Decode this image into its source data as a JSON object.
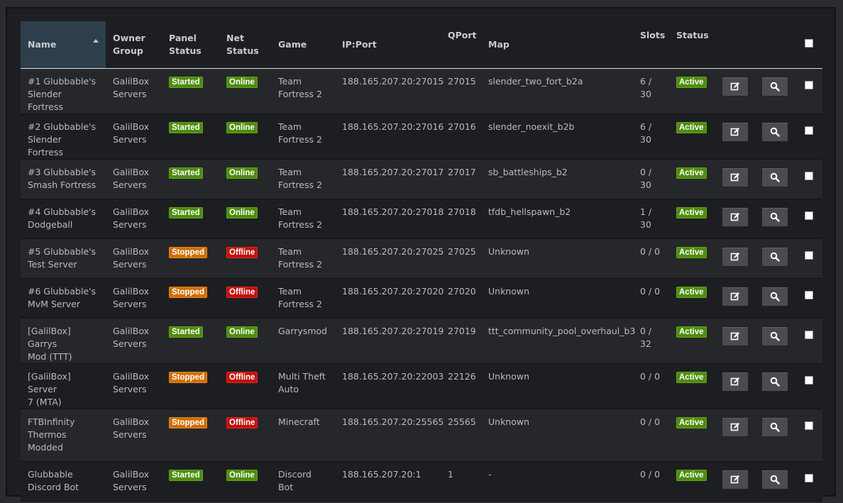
{
  "columns": {
    "name": [
      "Name"
    ],
    "owner": [
      "Owner",
      "Group"
    ],
    "panel": [
      "Panel",
      "Status"
    ],
    "net": [
      "Net",
      "Status"
    ],
    "game": [
      "Game"
    ],
    "ip": [
      "IP:Port"
    ],
    "qport": [
      "QPort"
    ],
    "map": [
      "Map"
    ],
    "slots": [
      "Slots"
    ],
    "status": [
      "Status"
    ]
  },
  "colors": {
    "started": "#4e8d0e",
    "stopped": "#d06f06",
    "offline": "#c4100c",
    "header_sorted": "#2d3f4c"
  },
  "icons": {
    "edit": "edit-icon",
    "view": "search-icon"
  },
  "rows": [
    {
      "name": [
        "#1 Glubbable's",
        "Slender Fortress"
      ],
      "owner": [
        "GalilBox",
        "Servers"
      ],
      "panel": "Started",
      "net": "Online",
      "game": [
        "Team",
        "Fortress 2"
      ],
      "ip": "188.165.207.20:27015",
      "qport": "27015",
      "map": "slender_two_fort_b2a",
      "slots": [
        "6 /",
        "30"
      ],
      "status": "Active"
    },
    {
      "name": [
        "#2 Glubbable's",
        "Slender Fortress"
      ],
      "owner": [
        "GalilBox",
        "Servers"
      ],
      "panel": "Started",
      "net": "Online",
      "game": [
        "Team",
        "Fortress 2"
      ],
      "ip": "188.165.207.20:27016",
      "qport": "27016",
      "map": "slender_noexit_b2b",
      "slots": [
        "6 /",
        "30"
      ],
      "status": "Active"
    },
    {
      "name": [
        "#3 Glubbable's",
        "Smash Fortress"
      ],
      "owner": [
        "GalilBox",
        "Servers"
      ],
      "panel": "Started",
      "net": "Online",
      "game": [
        "Team",
        "Fortress 2"
      ],
      "ip": "188.165.207.20:27017",
      "qport": "27017",
      "map": "sb_battleships_b2",
      "slots": [
        "0 /",
        "30"
      ],
      "status": "Active"
    },
    {
      "name": [
        "#4 Glubbable's",
        "Dodgeball"
      ],
      "owner": [
        "GalilBox",
        "Servers"
      ],
      "panel": "Started",
      "net": "Online",
      "game": [
        "Team",
        "Fortress 2"
      ],
      "ip": "188.165.207.20:27018",
      "qport": "27018",
      "map": "tfdb_hellspawn_b2",
      "slots": [
        "1 /",
        "30"
      ],
      "status": "Active"
    },
    {
      "name": [
        "#5 Glubbable's",
        "Test Server"
      ],
      "owner": [
        "GalilBox",
        "Servers"
      ],
      "panel": "Stopped",
      "net": "Offline",
      "game": [
        "Team",
        "Fortress 2"
      ],
      "ip": "188.165.207.20:27025",
      "qport": "27025",
      "map": "Unknown",
      "slots": [
        "0 / 0"
      ],
      "status": "Active"
    },
    {
      "name": [
        "#6 Glubbable's",
        "MvM Server"
      ],
      "owner": [
        "GalilBox",
        "Servers"
      ],
      "panel": "Stopped",
      "net": "Offline",
      "game": [
        "Team",
        "Fortress 2"
      ],
      "ip": "188.165.207.20:27020",
      "qport": "27020",
      "map": "Unknown",
      "slots": [
        "0 / 0"
      ],
      "status": "Active"
    },
    {
      "name": [
        "[GalilBox] Garrys",
        "Mod (TTT)"
      ],
      "owner": [
        "GalilBox",
        "Servers"
      ],
      "panel": "Started",
      "net": "Online",
      "game": [
        "Garrysmod"
      ],
      "ip": "188.165.207.20:27019",
      "qport": "27019",
      "map": "ttt_community_pool_overhaul_b3",
      "slots": [
        "0 /",
        "32"
      ],
      "status": "Active"
    },
    {
      "name": [
        "[GalilBox] Server",
        "7 (MTA)"
      ],
      "owner": [
        "GalilBox",
        "Servers"
      ],
      "panel": "Stopped",
      "net": "Offline",
      "game": [
        "Multi Theft",
        "Auto"
      ],
      "ip": "188.165.207.20:22003",
      "qport": "22126",
      "map": "Unknown",
      "slots": [
        "0 / 0"
      ],
      "status": "Active"
    },
    {
      "name": [
        "FTBInfinity",
        "Thermos",
        "Modded"
      ],
      "owner": [
        "GalilBox",
        "Servers"
      ],
      "panel": "Stopped",
      "net": "Offline",
      "game": [
        "Minecraft"
      ],
      "ip": "188.165.207.20:25565",
      "qport": "25565",
      "map": "Unknown",
      "slots": [
        "0 / 0"
      ],
      "status": "Active"
    },
    {
      "name": [
        "Glubbable",
        "Discord Bot"
      ],
      "owner": [
        "GalilBox",
        "Servers"
      ],
      "panel": "Started",
      "net": "Online",
      "game": [
        "Discord Bot"
      ],
      "ip": "188.165.207.20:1",
      "qport": "1",
      "map": "-",
      "slots": [
        "0 / 0"
      ],
      "status": "Active"
    }
  ]
}
